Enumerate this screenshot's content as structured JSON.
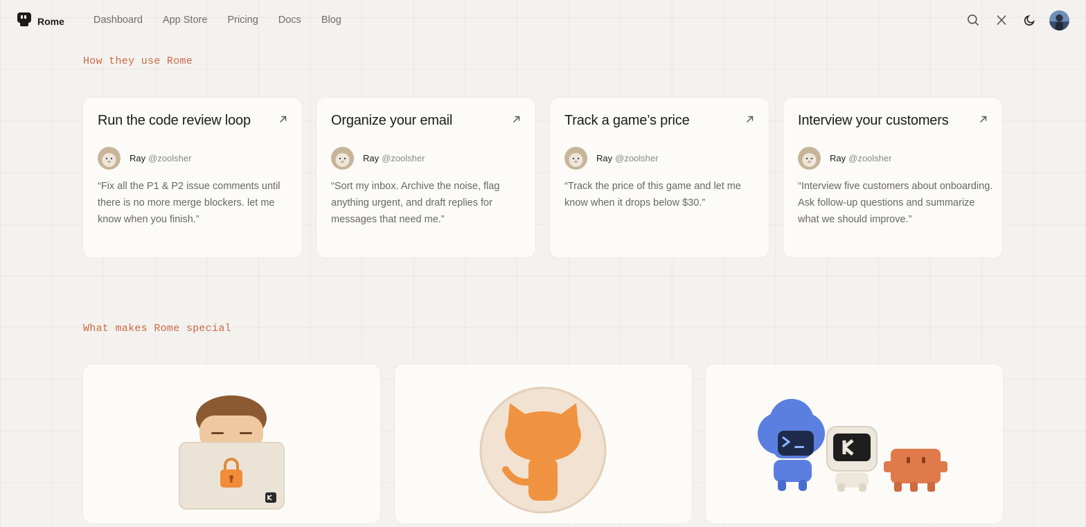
{
  "nav": {
    "brand": "Rome",
    "links": [
      "Dashboard",
      "App Store",
      "Pricing",
      "Docs",
      "Blog"
    ]
  },
  "sections": {
    "usage_title": "How they use Rome",
    "special_title": "What makes Rome special"
  },
  "cards": [
    {
      "title": "Run the code review loop",
      "author_name": "Ray",
      "author_handle": "@zoolsher",
      "quote": "“Fix all the P1 & P2 issue comments until there is no more merge blockers. let me know when you finish.”"
    },
    {
      "title": "Organize your email",
      "author_name": "Ray",
      "author_handle": "@zoolsher",
      "quote": "“Sort my inbox. Archive the noise, flag anything urgent, and draft replies for messages that need me.”"
    },
    {
      "title": "Track a game’s price",
      "author_name": "Ray",
      "author_handle": "@zoolsher",
      "quote": "“Track the price of this game and let me know when it drops below $30.”"
    },
    {
      "title": "Interview your customers",
      "author_name": "Ray",
      "author_handle": "@zoolsher",
      "quote": "“Interview five customers about onboarding. Ask follow-up questions and summarize what we should improve.”"
    }
  ],
  "icons": {
    "logo": "rome-logo-icon",
    "search": "search-icon",
    "x": "x-logo-icon",
    "theme": "moon-icon",
    "card_link": "arrow-up-right-icon"
  },
  "colors": {
    "accent": "#c96a45",
    "background": "#f4f2ef",
    "card": "#fcfbf8"
  }
}
